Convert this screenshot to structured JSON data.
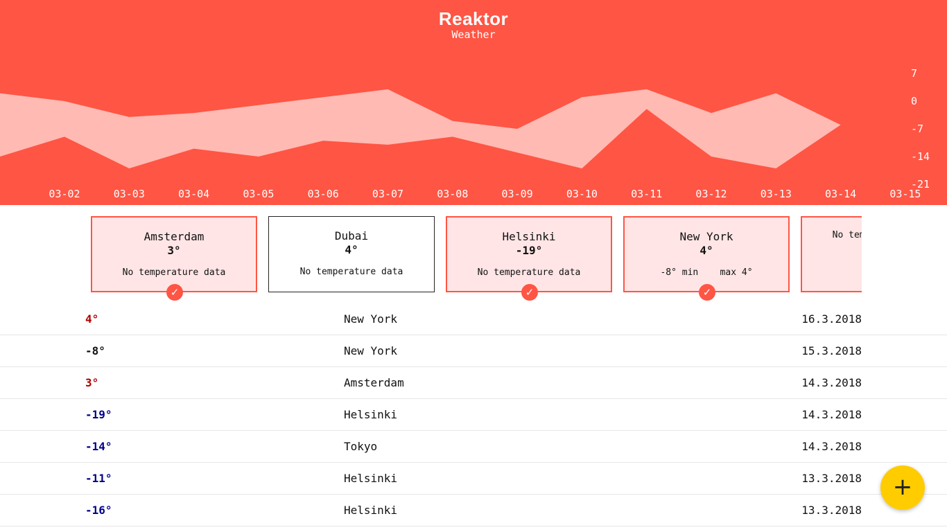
{
  "brand": {
    "name": "Reaktor",
    "subtitle": "Weather"
  },
  "colors": {
    "header_bg": "#ff5544",
    "band_fill": "#ffbab3",
    "accent": "#ff5544",
    "fab": "#ffcc00",
    "warm": "#b00000",
    "cold": "#00008b"
  },
  "chart_data": {
    "type": "area",
    "x": [
      "03-02",
      "03-03",
      "03-04",
      "03-05",
      "03-06",
      "03-07",
      "03-08",
      "03-09",
      "03-10",
      "03-11",
      "03-12",
      "03-13",
      "03-14",
      "03-15"
    ],
    "series": [
      {
        "values_max": [
          2,
          0,
          -4,
          -3,
          -1,
          1,
          3,
          -5,
          -7,
          1,
          3,
          -3,
          2,
          -6
        ]
      },
      {
        "values_min": [
          -14,
          -9,
          -17,
          -12,
          -14,
          -10,
          -11,
          -9,
          -13,
          -17,
          -2,
          -14,
          -17,
          -6
        ]
      }
    ],
    "x_ticks": [
      "03-02",
      "03-03",
      "03-04",
      "03-05",
      "03-06",
      "03-07",
      "03-08",
      "03-09",
      "03-10",
      "03-11",
      "03-12",
      "03-13",
      "03-14",
      "03-15"
    ],
    "y_ticks": [
      "7",
      "0",
      "-7",
      "-14",
      "-21"
    ],
    "ylim": [
      -21,
      7
    ]
  },
  "cards": [
    {
      "city": "Amsterdam",
      "temp": "3°",
      "info": "No temperature data",
      "selected": true
    },
    {
      "city": "Dubai",
      "temp": "4°",
      "info": "No temperature data",
      "selected": false
    },
    {
      "city": "Helsinki",
      "temp": "-19°",
      "info": "No temperature data",
      "selected": true
    },
    {
      "city": "New York",
      "temp": "4°",
      "info": "-8° min    max 4°",
      "selected": true
    },
    {
      "city": "",
      "temp": "",
      "info": "No temperature data",
      "selected": true
    }
  ],
  "check_glyph": "✓",
  "observations": [
    {
      "temp": "4°",
      "city": "New York",
      "date": "16.3.2018",
      "tone": "warm"
    },
    {
      "temp": "-8°",
      "city": "New York",
      "date": "15.3.2018",
      "tone": "neutral"
    },
    {
      "temp": "3°",
      "city": "Amsterdam",
      "date": "14.3.2018",
      "tone": "warm"
    },
    {
      "temp": "-19°",
      "city": "Helsinki",
      "date": "14.3.2018",
      "tone": "cold"
    },
    {
      "temp": "-14°",
      "city": "Tokyo",
      "date": "14.3.2018",
      "tone": "cold"
    },
    {
      "temp": "-11°",
      "city": "Helsinki",
      "date": "13.3.2018",
      "tone": "cold"
    },
    {
      "temp": "-16°",
      "city": "Helsinki",
      "date": "13.3.2018",
      "tone": "cold"
    }
  ],
  "fab": {
    "label": "+",
    "icon": "plus-icon"
  }
}
